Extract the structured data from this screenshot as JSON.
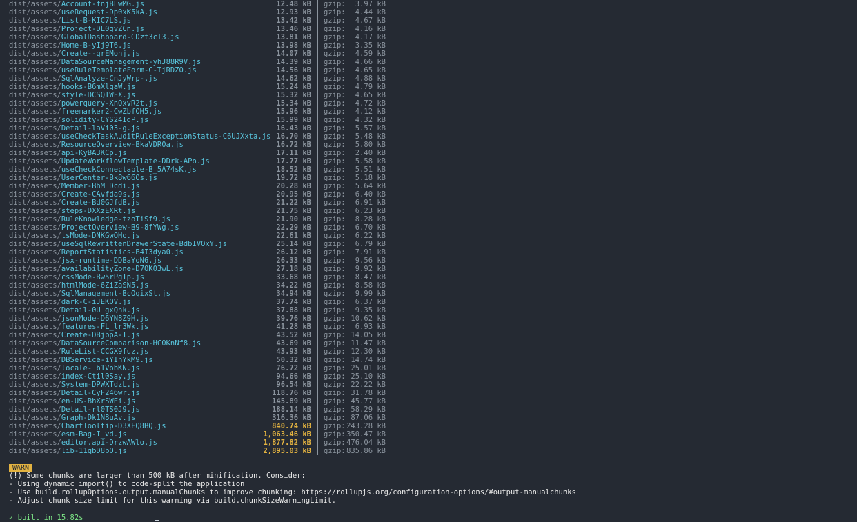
{
  "build": {
    "dir_prefix": "dist/assets/",
    "gzip_label": "gzip:",
    "rows": [
      {
        "file": "Account-fnjBLwMG.js",
        "size": "12.48 kB",
        "gzip": "3.97 kB",
        "big": false
      },
      {
        "file": "useRequest-Dp0xK5kA.js",
        "size": "12.93 kB",
        "gzip": "4.44 kB",
        "big": false
      },
      {
        "file": "List-B-KIC7LS.js",
        "size": "13.42 kB",
        "gzip": "4.67 kB",
        "big": false
      },
      {
        "file": "Project-DL0gvZCn.js",
        "size": "13.46 kB",
        "gzip": "4.16 kB",
        "big": false
      },
      {
        "file": "GlobalDashboard-CDzt3cT3.js",
        "size": "13.81 kB",
        "gzip": "4.17 kB",
        "big": false
      },
      {
        "file": "Home-B-yIj9T6.js",
        "size": "13.98 kB",
        "gzip": "3.35 kB",
        "big": false
      },
      {
        "file": "Create--grEMonj.js",
        "size": "14.07 kB",
        "gzip": "4.59 kB",
        "big": false
      },
      {
        "file": "DataSourceManagement-yhJ88R9V.js",
        "size": "14.39 kB",
        "gzip": "4.66 kB",
        "big": false
      },
      {
        "file": "useRuleTemplateForm-C-TjRDZO.js",
        "size": "14.56 kB",
        "gzip": "4.65 kB",
        "big": false
      },
      {
        "file": "SqlAnalyze-CnJyWrp-.js",
        "size": "14.62 kB",
        "gzip": "4.88 kB",
        "big": false
      },
      {
        "file": "hooks-B6mXlqaW.js",
        "size": "15.24 kB",
        "gzip": "4.79 kB",
        "big": false
      },
      {
        "file": "style-DCSQIWFX.js",
        "size": "15.32 kB",
        "gzip": "4.65 kB",
        "big": false
      },
      {
        "file": "powerquery-XnOxvR2t.js",
        "size": "15.34 kB",
        "gzip": "4.72 kB",
        "big": false
      },
      {
        "file": "freemarker2-CwZbfOH5.js",
        "size": "15.96 kB",
        "gzip": "4.12 kB",
        "big": false
      },
      {
        "file": "solidity-CYS24IdP.js",
        "size": "15.99 kB",
        "gzip": "4.32 kB",
        "big": false
      },
      {
        "file": "Detail-laVi03-g.js",
        "size": "16.43 kB",
        "gzip": "5.57 kB",
        "big": false
      },
      {
        "file": "useCheckTaskAuditRuleExceptionStatus-C6UJXxta.js",
        "size": "16.70 kB",
        "gzip": "5.48 kB",
        "big": false
      },
      {
        "file": "ResourceOverview-BkaVDR0a.js",
        "size": "16.72 kB",
        "gzip": "5.80 kB",
        "big": false
      },
      {
        "file": "api-KyBA3KCp.js",
        "size": "17.11 kB",
        "gzip": "2.40 kB",
        "big": false
      },
      {
        "file": "UpdateWorkflowTemplate-DDrk-APo.js",
        "size": "17.77 kB",
        "gzip": "5.58 kB",
        "big": false
      },
      {
        "file": "useCheckConnectable-B_5A74sK.js",
        "size": "18.52 kB",
        "gzip": "5.51 kB",
        "big": false
      },
      {
        "file": "UserCenter-Bk8w66Os.js",
        "size": "19.72 kB",
        "gzip": "5.18 kB",
        "big": false
      },
      {
        "file": "Member-BhM_Dcdi.js",
        "size": "20.28 kB",
        "gzip": "5.64 kB",
        "big": false
      },
      {
        "file": "Create-CAvfda9s.js",
        "size": "20.95 kB",
        "gzip": "6.40 kB",
        "big": false
      },
      {
        "file": "Create-Bd0GJfdB.js",
        "size": "21.22 kB",
        "gzip": "6.91 kB",
        "big": false
      },
      {
        "file": "steps-DXXzEXRt.js",
        "size": "21.75 kB",
        "gzip": "6.23 kB",
        "big": false
      },
      {
        "file": "RuleKnowledge-tzoTiSf9.js",
        "size": "21.90 kB",
        "gzip": "8.28 kB",
        "big": false
      },
      {
        "file": "ProjectOverview-B9-8fYWg.js",
        "size": "22.29 kB",
        "gzip": "6.70 kB",
        "big": false
      },
      {
        "file": "tsMode-DNKGwOHo.js",
        "size": "22.61 kB",
        "gzip": "6.22 kB",
        "big": false
      },
      {
        "file": "useSqlRewrittenDrawerState-BdbIVOxY.js",
        "size": "25.14 kB",
        "gzip": "6.79 kB",
        "big": false
      },
      {
        "file": "ReportStatistics-B4I3dya0.js",
        "size": "26.12 kB",
        "gzip": "7.91 kB",
        "big": false
      },
      {
        "file": "jsx-runtime-DDBaYoN6.js",
        "size": "26.33 kB",
        "gzip": "9.56 kB",
        "big": false
      },
      {
        "file": "availabilityZone-D7OK03wL.js",
        "size": "27.18 kB",
        "gzip": "9.92 kB",
        "big": false
      },
      {
        "file": "cssMode-Bw5rPgIp.js",
        "size": "33.68 kB",
        "gzip": "8.47 kB",
        "big": false
      },
      {
        "file": "htmlMode-6ZiZaSN5.js",
        "size": "34.22 kB",
        "gzip": "8.58 kB",
        "big": false
      },
      {
        "file": "SqlManagement-BcOqixSt.js",
        "size": "34.94 kB",
        "gzip": "9.99 kB",
        "big": false
      },
      {
        "file": "dark-C-iJEKOV.js",
        "size": "37.74 kB",
        "gzip": "6.37 kB",
        "big": false
      },
      {
        "file": "Detail-0U_gxQhk.js",
        "size": "37.88 kB",
        "gzip": "9.35 kB",
        "big": false
      },
      {
        "file": "jsonMode-D6YN8Z9H.js",
        "size": "39.76 kB",
        "gzip": "10.62 kB",
        "big": false
      },
      {
        "file": "features-FL_lr3Wk.js",
        "size": "41.28 kB",
        "gzip": "6.93 kB",
        "big": false
      },
      {
        "file": "Create-DBjbpA-I.js",
        "size": "43.52 kB",
        "gzip": "14.05 kB",
        "big": false
      },
      {
        "file": "DataSourceComparison-HC0KnNf8.js",
        "size": "43.69 kB",
        "gzip": "11.47 kB",
        "big": false
      },
      {
        "file": "RuleList-CCGX9fuz.js",
        "size": "43.93 kB",
        "gzip": "12.30 kB",
        "big": false
      },
      {
        "file": "DBService-iYIhYkM9.js",
        "size": "50.32 kB",
        "gzip": "14.74 kB",
        "big": false
      },
      {
        "file": "locale-_b1VobKN.js",
        "size": "76.72 kB",
        "gzip": "25.01 kB",
        "big": false
      },
      {
        "file": "index-Ctil0Say.js",
        "size": "94.66 kB",
        "gzip": "25.10 kB",
        "big": false
      },
      {
        "file": "System-DPWXTdzL.js",
        "size": "96.54 kB",
        "gzip": "22.22 kB",
        "big": false
      },
      {
        "file": "Detail-CyF246wr.js",
        "size": "118.76 kB",
        "gzip": "31.78 kB",
        "big": false
      },
      {
        "file": "en-US-BhXrSWEi.js",
        "size": "145.89 kB",
        "gzip": "45.77 kB",
        "big": false
      },
      {
        "file": "Detail-rl0TS0J9.js",
        "size": "188.14 kB",
        "gzip": "58.29 kB",
        "big": false
      },
      {
        "file": "Graph-Dk1N8uAv.js",
        "size": "316.36 kB",
        "gzip": "87.06 kB",
        "big": false
      },
      {
        "file": "ChartTooltip-D3XFQ8BQ.js",
        "size": "840.74 kB",
        "gzip": "243.28 kB",
        "big": true
      },
      {
        "file": "esm-Bag-I_vd.js",
        "size": "1,063.46 kB",
        "gzip": "350.47 kB",
        "big": true
      },
      {
        "file": "editor.api-DrzwAWlo.js",
        "size": "1,877.82 kB",
        "gzip": "476.04 kB",
        "big": true
      },
      {
        "file": "lib-11qbD8bO.js",
        "size": "2,895.03 kB",
        "gzip": "835.86 kB",
        "big": true
      }
    ]
  },
  "warning": {
    "badge": "WARN",
    "lines": [
      "(!) Some chunks are larger than 500 kB after minification. Consider:",
      "- Using dynamic import() to code-split the application",
      "- Use build.rollupOptions.output.manualChunks to improve chunking: https://rollupjs.org/configuration-options/#output-manualchunks",
      "- Adjust chunk size limit for this warning via build.chunkSizeWarningLimit."
    ]
  },
  "status": {
    "built": "✓ built in 15.82s"
  },
  "colors": {
    "background": "#252a33",
    "filename": "#58c4dc",
    "dim": "#8b949e",
    "warn": "#e3b341",
    "success": "#7ee787"
  }
}
